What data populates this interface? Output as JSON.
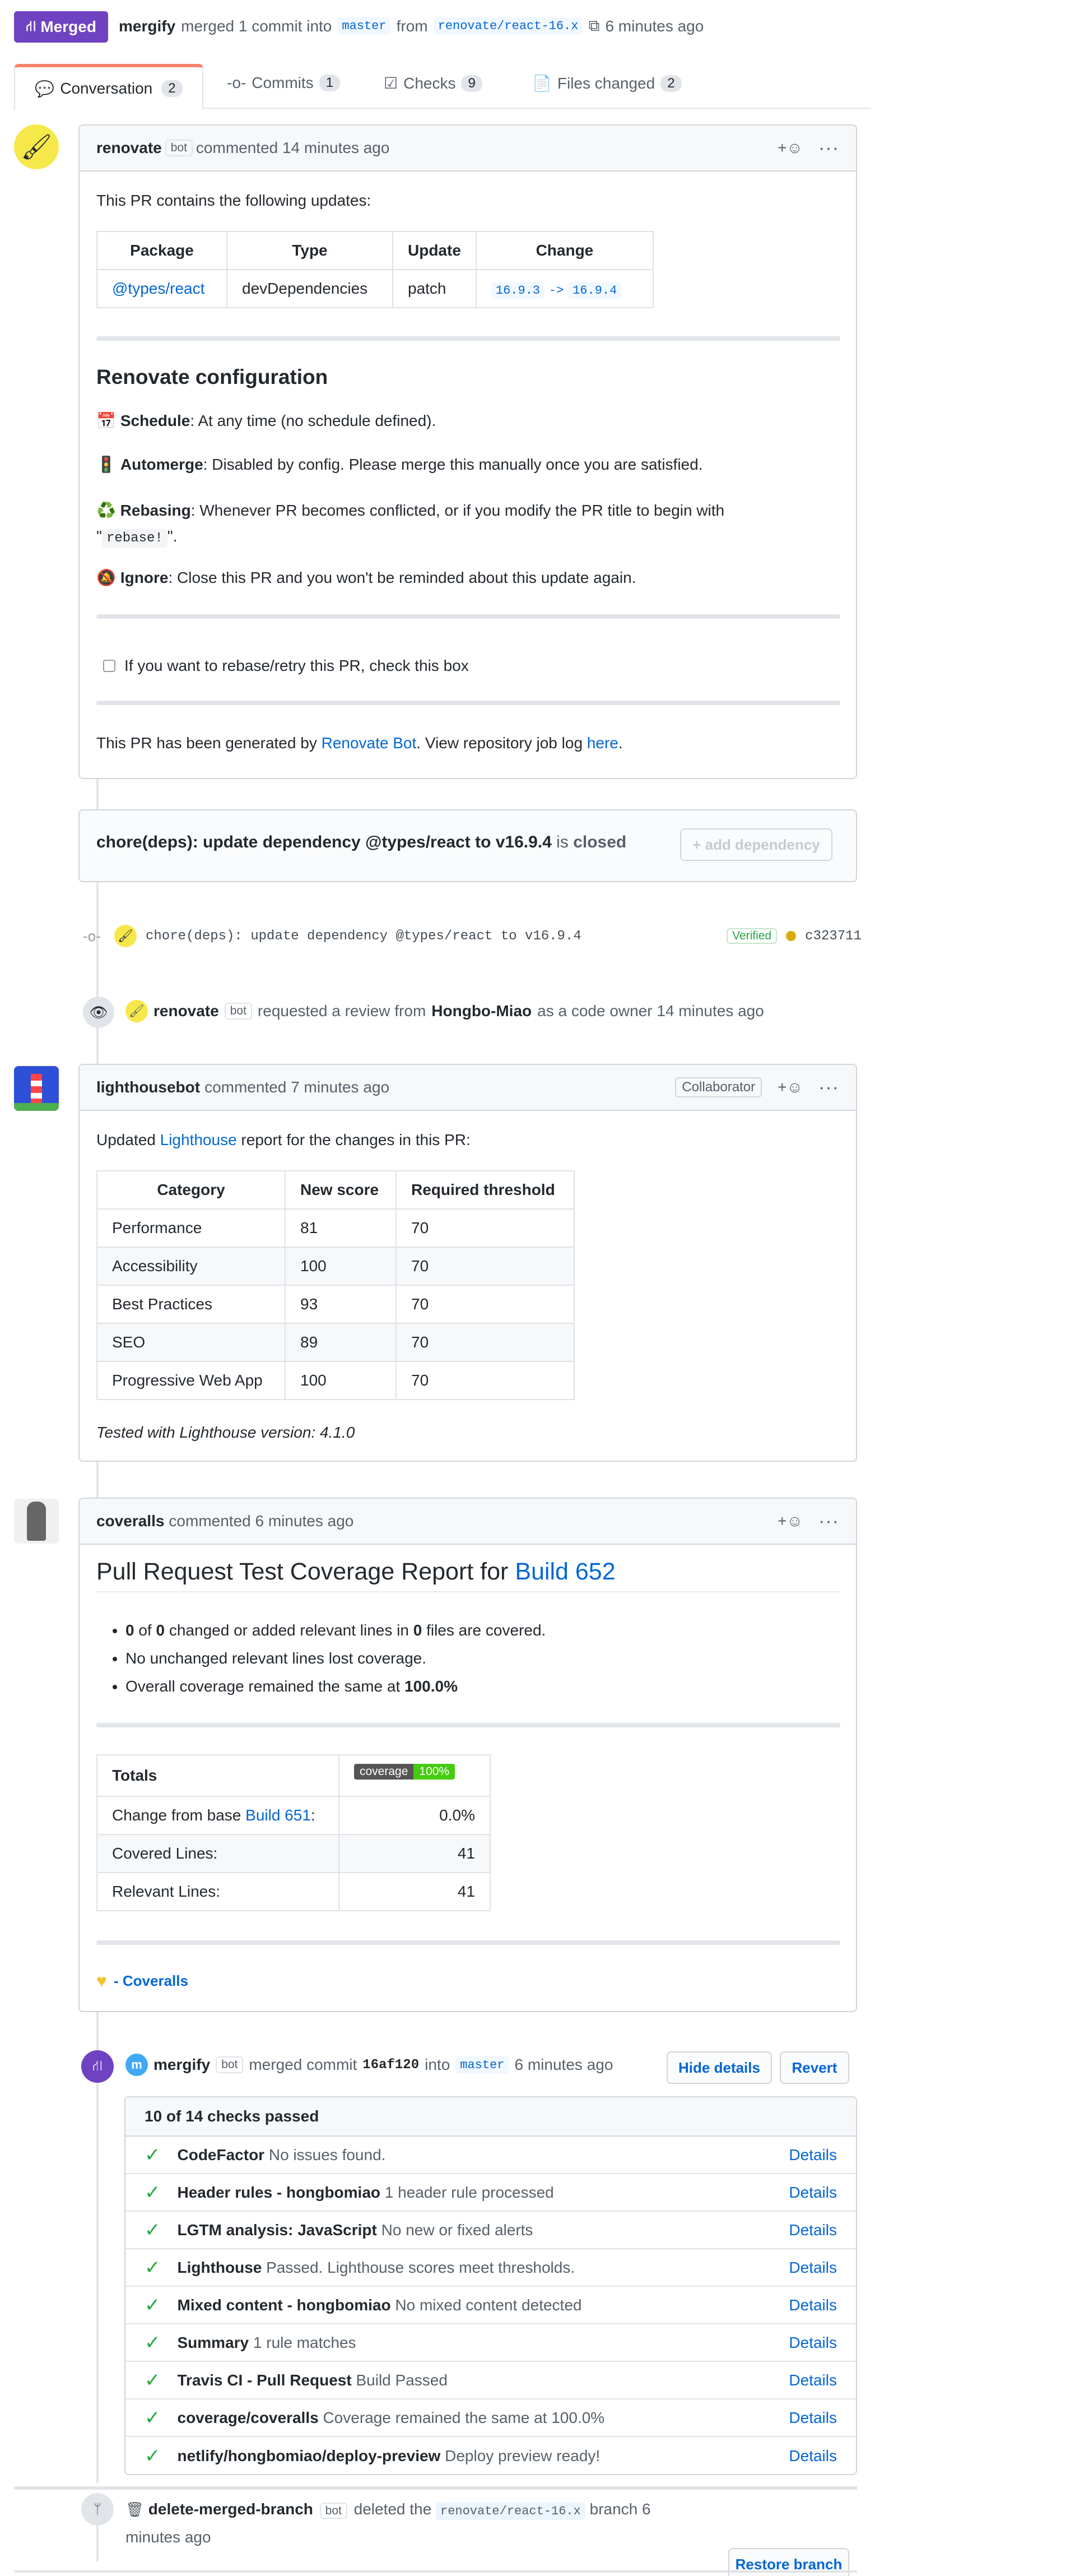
{
  "header": {
    "state": "Merged",
    "actor": "mergify",
    "action": "merged 1 commit into",
    "base_branch": "master",
    "from": "from",
    "head_branch": "renovate/react-16.x",
    "time": "6 minutes ago"
  },
  "tabs": [
    {
      "label": "Conversation",
      "count": "2"
    },
    {
      "label": "Commits",
      "count": "1"
    },
    {
      "label": "Checks",
      "count": "9"
    },
    {
      "label": "Files changed",
      "count": "2"
    }
  ],
  "renovate_comment": {
    "author": "renovate",
    "bot_label": "bot",
    "time": "commented 14 minutes ago",
    "intro": "This PR contains the following updates:",
    "table_headers": [
      "Package",
      "Type",
      "Update",
      "Change"
    ],
    "row": {
      "package": "@types/react",
      "type": "devDependencies",
      "update": "patch",
      "from": "16.9.3",
      "arrow": "->",
      "to": "16.9.4"
    },
    "config_title": "Renovate configuration",
    "schedule_label": "Schedule",
    "schedule_text": ": At any time (no schedule defined).",
    "automerge_label": "Automerge",
    "automerge_text": ": Disabled by config. Please merge this manually once you are satisfied.",
    "rebasing_label": "Rebasing",
    "rebasing_text": ": Whenever PR becomes conflicted, or if you modify the PR title to begin with",
    "rebasing_quote_open": "\"",
    "rebasing_code": "rebase!",
    "rebasing_quote_close": "\".",
    "ignore_label": "Ignore",
    "ignore_text": ": Close this PR and you won't be reminded about this update again.",
    "checkbox_text": "If you want to rebase/retry this PR, check this box",
    "footer_pre": "This PR has been generated by ",
    "footer_link": "Renovate Bot",
    "footer_mid": ". View repository job log ",
    "footer_link2": "here",
    "footer_end": "."
  },
  "dependency_box": {
    "title": "chore(deps): update dependency @types/react to v16.9.4",
    "status_pre": "is",
    "status": "closed",
    "button": "+ add dependency"
  },
  "commit_event": {
    "message": "chore(deps): update dependency @types/react to v16.9.4",
    "verified": "Verified",
    "sha": "c323711"
  },
  "review_event": {
    "actor": "renovate",
    "bot_label": "bot",
    "text": "requested a review from",
    "reviewer": "Hongbo-Miao",
    "suffix": "as a code owner 14 minutes ago"
  },
  "lighthouse_comment": {
    "author": "lighthousebot",
    "time": "commented 7 minutes ago",
    "role": "Collaborator",
    "intro_pre": "Updated ",
    "intro_link": "Lighthouse",
    "intro_post": " report for the changes in this PR:",
    "headers": [
      "Category",
      "New score",
      "Required threshold"
    ],
    "rows": [
      [
        "Performance",
        "81",
        "70"
      ],
      [
        "Accessibility",
        "100",
        "70"
      ],
      [
        "Best Practices",
        "93",
        "70"
      ],
      [
        "SEO",
        "89",
        "70"
      ],
      [
        "Progressive Web App",
        "100",
        "70"
      ]
    ],
    "footer": "Tested with Lighthouse version: 4.1.0"
  },
  "coveralls_comment": {
    "author": "coveralls",
    "time": "commented 6 minutes ago",
    "title_pre": "Pull Request Test Coverage Report for ",
    "title_link": "Build 652",
    "bullet1": {
      "a": "0",
      "b": " of ",
      "c": "0",
      "d": " changed or added relevant lines in ",
      "e": "0",
      "f": " files are covered."
    },
    "bullet2": "No unchanged relevant lines lost coverage.",
    "bullet3_pre": "Overall coverage remained the same at ",
    "bullet3_val": "100.0%",
    "totals_label": "Totals",
    "badge_left": "coverage",
    "badge_right": "100%",
    "change_pre": "Change from base ",
    "change_link": "Build 651",
    "change_post": ":",
    "change_val": "0.0%",
    "covered_label": "Covered Lines:",
    "covered_val": "41",
    "relevant_label": "Relevant Lines:",
    "relevant_val": "41",
    "signature": "- Coveralls"
  },
  "merge_event": {
    "actor": "mergify",
    "bot_label": "bot",
    "text": "merged commit",
    "sha": "16af120",
    "into": "into",
    "branch": "master",
    "time": "6 minutes ago",
    "hide_details": "Hide details",
    "revert": "Revert",
    "checks_summary": "10 of 14 checks passed",
    "details_label": "Details",
    "checks": [
      {
        "name": "CodeFactor",
        "desc": "No issues found."
      },
      {
        "name": "Header rules - hongbomiao",
        "desc": "1 header rule processed"
      },
      {
        "name": "LGTM analysis: JavaScript",
        "desc": "No new or fixed alerts"
      },
      {
        "name": "Lighthouse",
        "desc": "Passed. Lighthouse scores meet thresholds."
      },
      {
        "name": "Mixed content - hongbomiao",
        "desc": "No mixed content detected"
      },
      {
        "name": "Summary",
        "desc": "1 rule matches"
      },
      {
        "name": "Travis CI - Pull Request",
        "desc": "Build Passed"
      },
      {
        "name": "coverage/coveralls",
        "desc": "Coverage remained the same at 100.0%"
      },
      {
        "name": "netlify/hongbomiao/deploy-preview",
        "desc": "Deploy preview ready!"
      }
    ]
  },
  "delete_event": {
    "actor": "delete-merged-branch",
    "bot_label": "bot",
    "text": "deleted the",
    "branch": "renovate/react-16.x",
    "suffix": "branch 6",
    "time_line2": "minutes ago",
    "restore": "Restore branch"
  }
}
